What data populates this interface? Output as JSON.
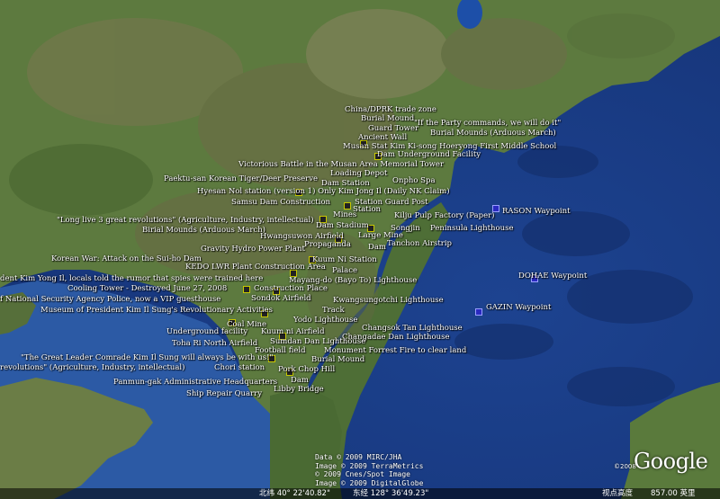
{
  "colors": {
    "sea": "#1b3d86",
    "deep_sea": "#142f70",
    "land": "#5a7a3c",
    "mountain": "#6b6a4c",
    "pin_border": "#c8c800",
    "waypoint": "#2a2ac0"
  },
  "labels": {
    "trade_zone": "China/DPRK trade zone",
    "burial_mound": "Burial Mound",
    "party_commands": "\"If the Party commands, we will do it\"",
    "guard_tower": "Guard Tower",
    "burial_mounds_arduous_1": "Burial Mounds (Arduous March)",
    "ancient_wall": "Ancient Wall",
    "musan_school": "Musan Stat Kim Ki-song Hoeryong First Middle School",
    "dam_underground": "Dam Underground Facility",
    "musan_memorial": "Victorious Battle in the Musan Area Memorial Tower",
    "loading_depot": "Loading Depot",
    "paektu_preserve": "Paektu-san Korean Tiger/Deer Preserve",
    "dam_station": "Dam Station",
    "onpho_spa": "Onpho Spa",
    "hyesan_nol": "Hyesan Nol station (version 1) Only Kim Jong Il (Daily NK Claim)",
    "samsu_dam": "Samsu Dam Construction",
    "station_guard_post": "Station Guard Post",
    "station_1": "Station",
    "long_live": "\"Long live 3 great revolutions\" (Agriculture, Industry, intellectual)",
    "mines": "Mines",
    "kilju_pulp": "Kilju Pulp Factory (Paper)",
    "burial_mounds_arduous_2": "Birial Mounds (Arduous March)",
    "dam_stadium": "Dam Stadium",
    "songjin": "Songjin",
    "peninsula_lighthouse": "Peninsula Lighthouse",
    "rason": "RASON Waypoint",
    "hwangsuwon": "Hwangsuwon Airfield",
    "large_mine": "Large Mine",
    "propaganda": "Propaganda",
    "dam_2": "Dam",
    "tanchon": "Tanchon Airstrip",
    "gravity_hydro": "Gravity Hydro Power Plant",
    "korean_war": "Korean War: Attack on the Sui-ho Dam",
    "kuum_ni_station": "Kuum Ni Station",
    "kedo": "KEDO LWR Plant Construction Area",
    "palace": "Palace",
    "dohae": "DOHAE Waypoint",
    "kim_rumor": "dent Kim Yong Il, locals told the rumor that spies were trained here",
    "mayang": "Mayang-do (Bayo To) Lighthouse",
    "cooling_tower": "Cooling Tower - Destroyed June 27, 2008",
    "construction_place": "Construction Place",
    "nsa_guesthouse": "f National Security Agency Police, now a VIP guesthouse",
    "sondok": "Sondok Airfield",
    "dam_3": "Dam",
    "kwangsungotchi": "Kwangsungotchi Lighthouse",
    "museum": "Museum of President Kim Il Sung's Revolutionary Activities",
    "track": "Track",
    "gazin": "GAZIN Waypoint",
    "yodo": "Yodo Lighthouse",
    "coal_mine": "Coal Mine",
    "changsok": "Changsok Tan Lighthouse",
    "underground": "Underground facility",
    "kuum_ni_airfield": "Kuum ni Airfield",
    "changadae": "Changadae Dan Lighthouse",
    "sumdan": "Sumdan Dan Lighthouse",
    "toha": "Toha Ri North Airfield",
    "football": "Football field",
    "forrest_fire": "Monument Forrest Fire to clear land",
    "great_leader": "\"The Great Leader Comrade Kim Il Sung will always be with us!\"",
    "burial_mound_2": "Burial Mound",
    "revolutions_tail": "revolutions\" (Agriculture, Industry, intellectual)",
    "chori": "Chori station",
    "pork_chop": "Pork Chop Hill",
    "panmun": "Panmun-gak Administrative Headquarters",
    "dam_4": "Dam",
    "libby": "Libby Bridge",
    "ship_repair": "Ship Repair Quarry"
  },
  "credits": [
    "Data © 2009 MIRC/JHA",
    "Image © 2009 TerraMetrics",
    "© 2009 Cnes/Spot Image",
    "Image © 2009 DigitalGlobe"
  ],
  "logo": {
    "text": "Google",
    "year": "©2008"
  },
  "status": {
    "lat": "北纬 40° 22'40.82\"",
    "lon": "东经 128° 36'49.23\"",
    "eye_alt_label": "视点高度",
    "eye_alt_value": "857.00 英里"
  }
}
